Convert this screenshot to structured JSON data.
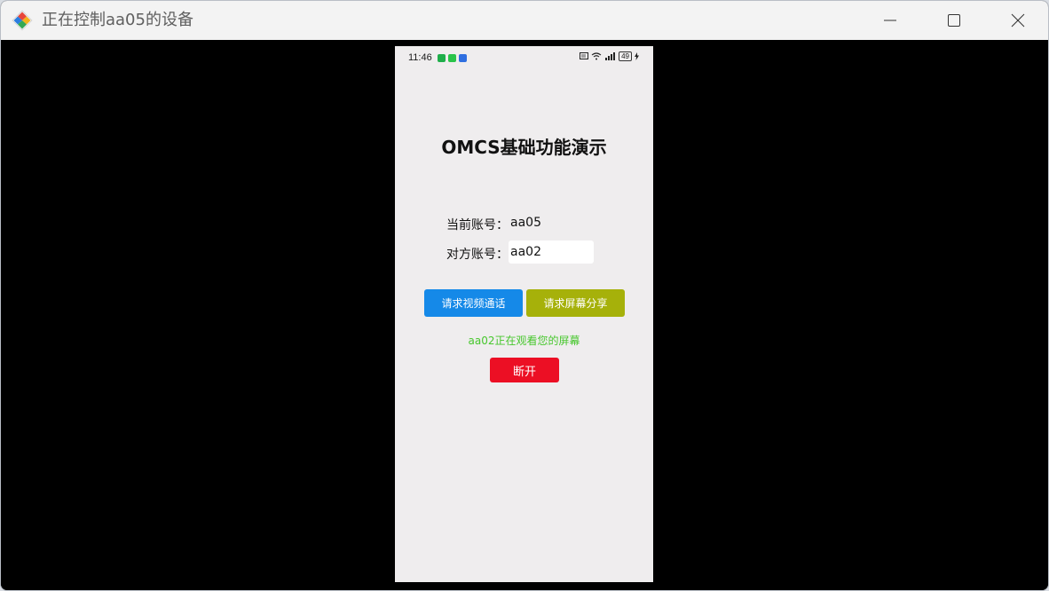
{
  "window": {
    "title": "正在控制aa05的设备",
    "controls": [
      "minimize-icon",
      "maximize-icon",
      "close-icon"
    ]
  },
  "phone": {
    "status_bar": {
      "time": "11:46",
      "battery": "49"
    },
    "app_title": "OMCS基础功能演示",
    "current_account": {
      "label": "当前账号：",
      "value": "aa05"
    },
    "peer_account": {
      "label": "对方账号：",
      "value": "aa02"
    },
    "buttons": {
      "video_call": "请求视频通话",
      "screen_share": "请求屏幕分享",
      "disconnect": "断开"
    },
    "status_message": "aa02正在观看您的屏幕"
  },
  "colors": {
    "video_button": "#1589e8",
    "share_button": "#a6b10a",
    "disconnect_button": "#ec0f24",
    "status_text": "#47c72d",
    "phone_background": "#efedee"
  }
}
